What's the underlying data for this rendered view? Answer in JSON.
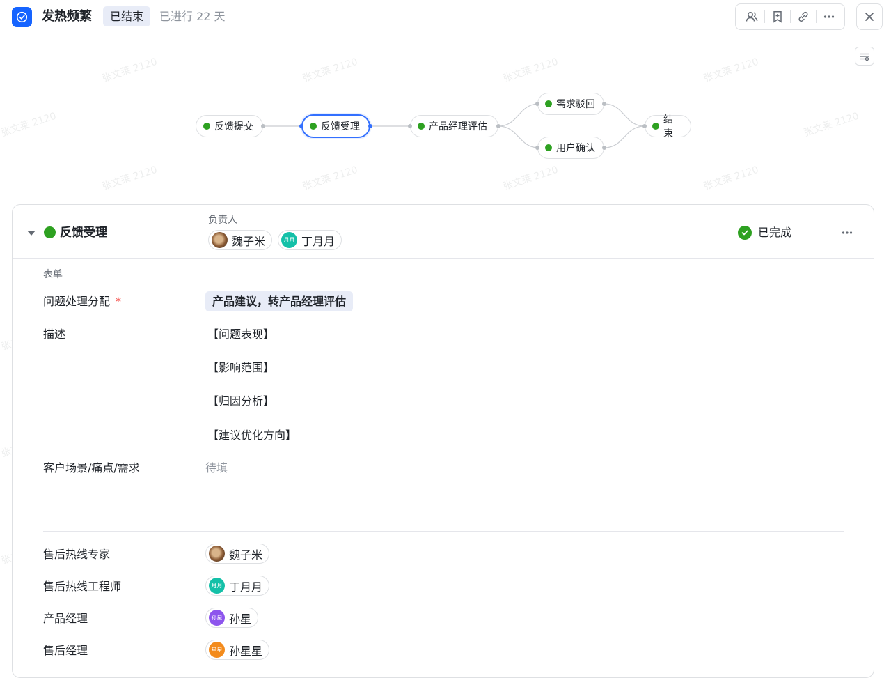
{
  "header": {
    "title": "发热频繁",
    "status": "已结束",
    "elapsed": "已进行 22 天"
  },
  "toolbar": {
    "icons": [
      "members-icon",
      "bookmark-add-icon",
      "link-icon",
      "more-icon"
    ],
    "close_icon": "close-icon"
  },
  "flow": {
    "settings_icon": "flow-settings-icon",
    "nodes": [
      {
        "label": "反馈提交",
        "status": "done"
      },
      {
        "label": "反馈受理",
        "status": "done",
        "active": true
      },
      {
        "label": "产品经理评估",
        "status": "done"
      },
      {
        "label": "需求驳回",
        "status": "done"
      },
      {
        "label": "用户确认",
        "status": "done"
      },
      {
        "label": "结束",
        "status": "done"
      }
    ]
  },
  "stage": {
    "name": "反馈受理",
    "owner_label": "负责人",
    "owners": [
      {
        "name": "魏子米",
        "avatar": "photo"
      },
      {
        "name": "丁月月",
        "avatar_text": "月月",
        "avatar_color": "#14c0a8"
      }
    ],
    "status": "已完成"
  },
  "form": {
    "title": "表单",
    "assignment": {
      "label": "问题处理分配",
      "required_mark": "*",
      "value": "产品建议，转产品经理评估"
    },
    "description": {
      "label": "描述",
      "lines": [
        "【问题表现】",
        "【影响范围】",
        "【归因分析】",
        "【建议优化方向】"
      ]
    },
    "scenario": {
      "label": "客户场景/痛点/需求",
      "placeholder": "待填"
    },
    "roles": [
      {
        "label": "售后热线专家",
        "person": "魏子米",
        "avatar": "photo"
      },
      {
        "label": "售后热线工程师",
        "person": "丁月月",
        "avatar_text": "月月",
        "avatar_color": "#14c0a8"
      },
      {
        "label": "产品经理",
        "person": "孙星",
        "avatar_text": "孙星",
        "avatar_color": "#8d55ed"
      },
      {
        "label": "售后经理",
        "person": "孙星星",
        "avatar_text": "星星",
        "avatar_color": "#f38b1c"
      }
    ]
  },
  "watermark": "张文莱 2120",
  "colors": {
    "accent": "#3370ff",
    "brand": "#1664ff",
    "success": "#2ea121",
    "tag_bg": "#e8ecf7"
  }
}
